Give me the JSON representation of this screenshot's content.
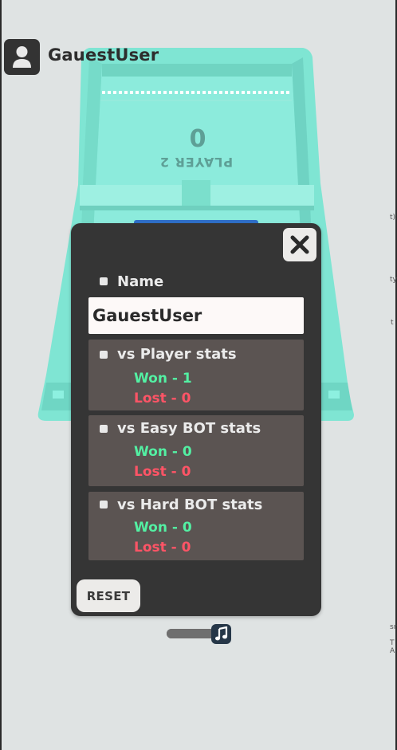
{
  "header": {
    "username": "GauestUser"
  },
  "board": {
    "player_label": "PLAYER 2",
    "score": "0"
  },
  "profile_modal": {
    "name_label": "Name",
    "name_value": "GauestUser",
    "stats": [
      {
        "title": "vs Player stats",
        "won": "Won - 1",
        "lost": "Lost - 0"
      },
      {
        "title": "vs Easy BOT stats",
        "won": "Won - 0",
        "lost": "Lost - 0"
      },
      {
        "title": "vs Hard BOT stats",
        "won": "Won - 0",
        "lost": "Lost - 0"
      }
    ],
    "reset_label": "RESET"
  },
  "music": {
    "volume_percent": 80,
    "icon": "music-note-icon"
  },
  "colors": {
    "board": "#7fe6d5",
    "modal_bg": "#353535",
    "card_bg": "#5b5452",
    "won": "#53f0a3",
    "lost": "#ff5466",
    "knob": "#263748"
  }
}
